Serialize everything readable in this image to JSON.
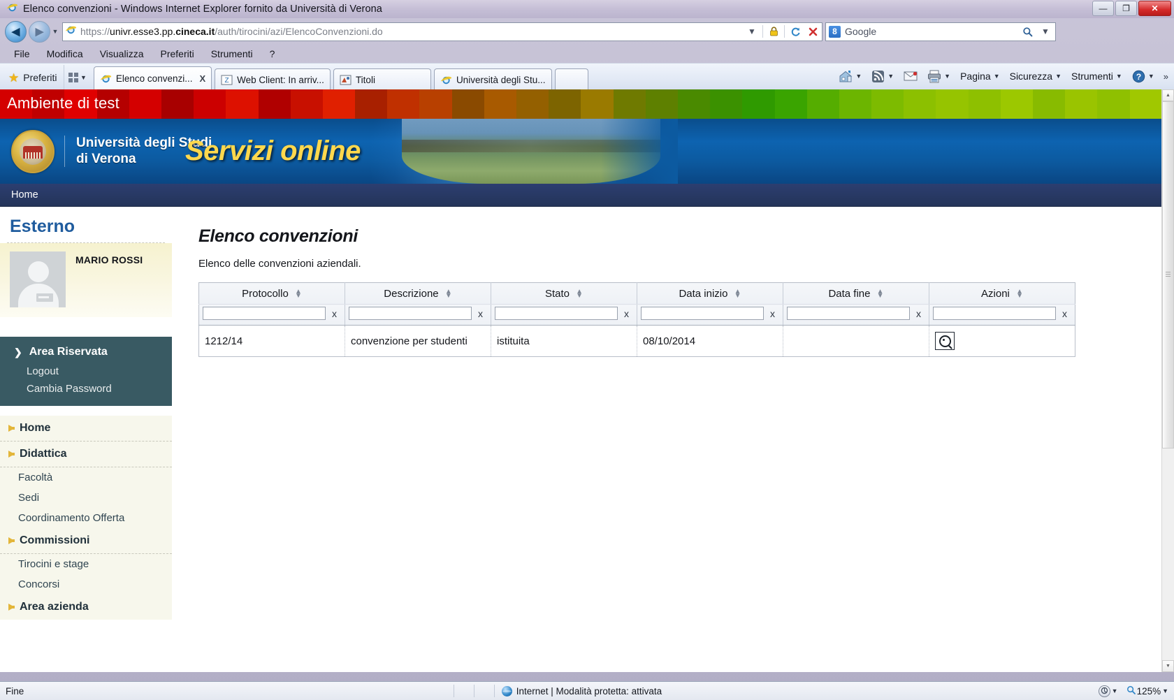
{
  "window": {
    "title": "Elenco convenzioni - Windows Internet Explorer fornito da Università di Verona",
    "minimize_label": "—",
    "restore_label": "❐",
    "close_label": "✕"
  },
  "navigation": {
    "back_label": "◀",
    "forward_label": "▶",
    "history_label": "▼",
    "url_prefix": "https://",
    "url_host_pre": "univr.esse3.pp.",
    "url_host_bold": "cineca.it",
    "url_path": "/auth/tirocini/azi/ElencoConvenzioni.do",
    "dropdown_label": "▼",
    "lock_label": "🔒",
    "refresh_label": "↻",
    "stop_label": "✕"
  },
  "search": {
    "engine_icon": "8",
    "placeholder": "Google",
    "value": "Google",
    "go_label": "🔍",
    "options_label": "▼"
  },
  "menubar": {
    "items": [
      "File",
      "Modifica",
      "Visualizza",
      "Preferiti",
      "Strumenti",
      "?"
    ]
  },
  "favorites": {
    "label": "Preferiti",
    "bar_toggle_label": "▼"
  },
  "tabs": [
    {
      "label": "Elenco convenzi...",
      "close_label": "X",
      "active": true,
      "icon": "ie-icon"
    },
    {
      "label": "Web Client: In arriv...",
      "close_label": "",
      "active": false,
      "icon": "zimbra-icon"
    },
    {
      "label": "Titoli",
      "close_label": "",
      "active": false,
      "icon": "app-icon"
    },
    {
      "label": "Università degli Stu...",
      "close_label": "",
      "active": false,
      "icon": "ie-icon"
    }
  ],
  "commandbar": {
    "home_label": "",
    "feeds_label": "",
    "mail_label": "",
    "print_label": "",
    "items": [
      "Pagina",
      "Sicurezza",
      "Strumenti"
    ],
    "help_label": "?",
    "overflow_label": "»",
    "caret": "▼"
  },
  "page": {
    "test_banner": "Ambiente di test",
    "university_name_line1": "Università degli Studi",
    "university_name_line2": "di Verona",
    "portal_title": "Servizi online",
    "nav": [
      "Home"
    ],
    "title": "Elenco convenzioni",
    "intro": "Elenco delle convenzioni aziendali."
  },
  "sidebar": {
    "section_title": "Esterno",
    "user_name": "MARIO ROSSI",
    "reserved_area": {
      "title": "Area Riservata",
      "chevron": "❯",
      "items": [
        "Logout",
        "Cambia Password"
      ]
    },
    "menu": [
      {
        "label": "Home",
        "type": "head"
      },
      {
        "label": "Didattica",
        "type": "head"
      },
      {
        "label": "Facoltà",
        "type": "link"
      },
      {
        "label": "Sedi",
        "type": "link"
      },
      {
        "label": "Coordinamento Offerta",
        "type": "link"
      },
      {
        "label": "Commissioni",
        "type": "head"
      },
      {
        "label": "Tirocini e stage",
        "type": "link"
      },
      {
        "label": "Concorsi",
        "type": "link"
      },
      {
        "label": "Area azienda",
        "type": "head"
      }
    ]
  },
  "table": {
    "columns": [
      {
        "label": "Protocollo",
        "filter_value": "",
        "clear_label": "x"
      },
      {
        "label": "Descrizione",
        "filter_value": "",
        "clear_label": "x"
      },
      {
        "label": "Stato",
        "filter_value": "",
        "clear_label": "x"
      },
      {
        "label": "Data inizio",
        "filter_value": "",
        "clear_label": "x"
      },
      {
        "label": "Data fine",
        "filter_value": "",
        "clear_label": "x"
      },
      {
        "label": "Azioni",
        "filter_value": "",
        "clear_label": "x"
      }
    ],
    "rows": [
      {
        "protocollo": "1212/14",
        "descrizione": "convenzione per studenti",
        "stato": "istituita",
        "data_inizio": "08/10/2014",
        "data_fine": "",
        "azione_label": "search-action"
      }
    ]
  },
  "statusbar": {
    "status": "Fine",
    "zone": "Internet | Modalità protetta: attivata",
    "zone_caret": "▼",
    "zoom": "125%",
    "zoom_caret": "▼"
  },
  "colors": {
    "accent_blue": "#1f5c9e",
    "banner_blue": "#0c5aa0",
    "portal_yellow": "#ffd84d",
    "test_red": "#cc0000",
    "reserved_area_bg": "#395a63",
    "menu_bg": "#f7f7ec"
  }
}
